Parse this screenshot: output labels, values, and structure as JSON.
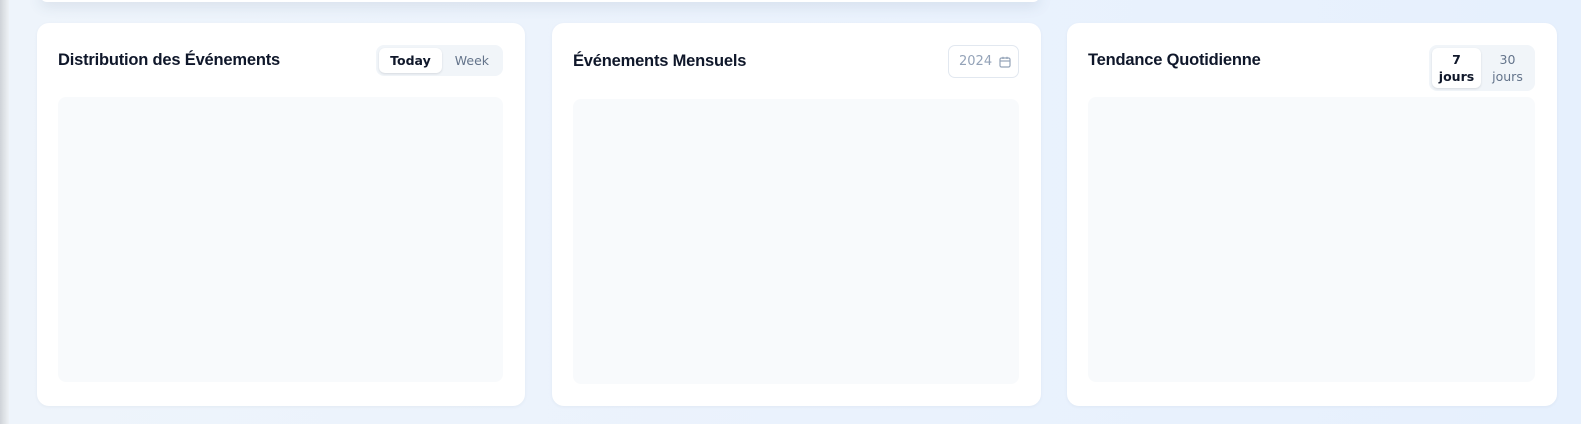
{
  "cards": [
    {
      "title": "Distribution des Événements",
      "toggle": [
        {
          "label": "Today",
          "active": true
        },
        {
          "label": "Week",
          "active": false
        }
      ]
    },
    {
      "title": "Événements Mensuels",
      "year_picker": {
        "value": "2024",
        "icon": "calendar-icon"
      }
    },
    {
      "title": "Tendance Quotidienne",
      "toggle": [
        {
          "label_line1": "7",
          "label_line2": "jours",
          "active": true
        },
        {
          "label_line1": "30",
          "label_line2": "jours",
          "active": false
        }
      ]
    }
  ],
  "colors": {
    "card_background": "#ffffff",
    "placeholder_background": "#f8fafc",
    "title_text": "#0f172a",
    "muted_text": "#64748b",
    "toggle_track": "#f1f5f9"
  }
}
